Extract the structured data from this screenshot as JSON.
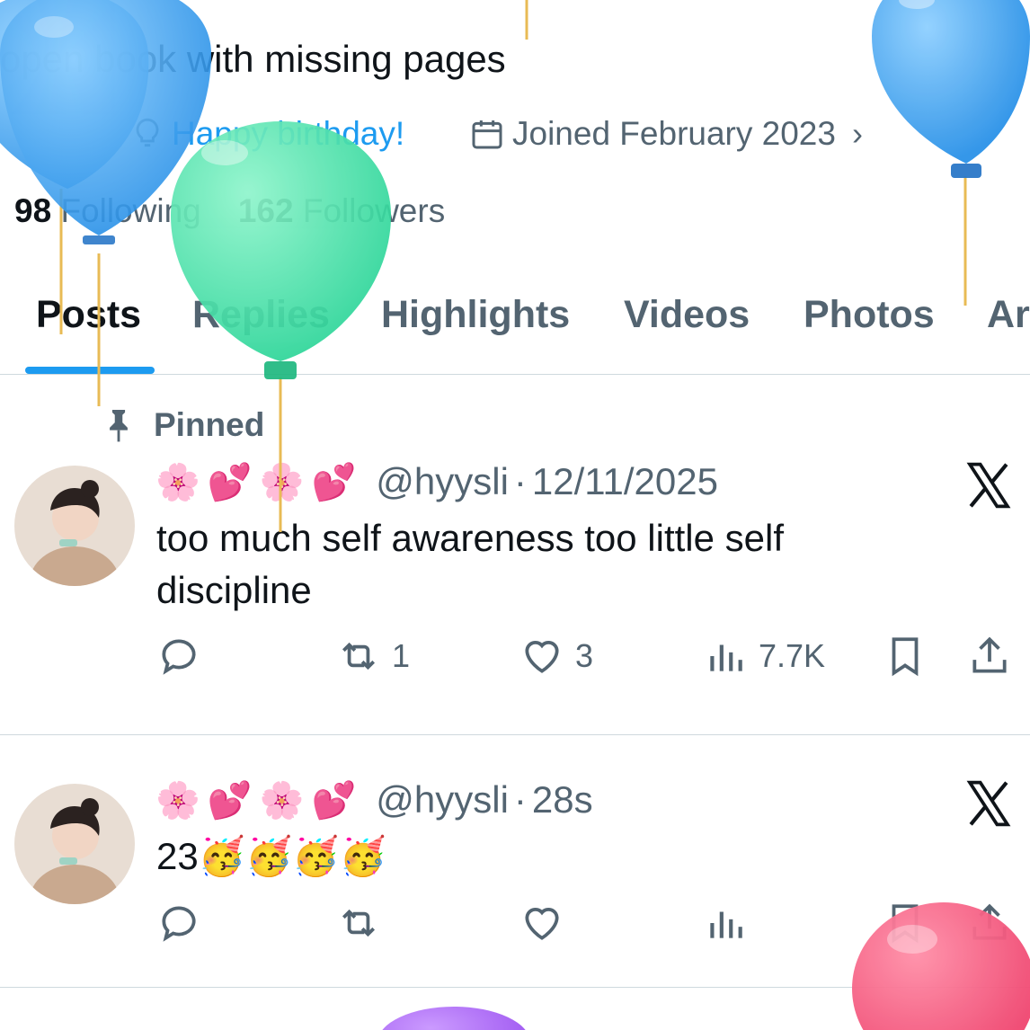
{
  "profile": {
    "bio": "open book with missing pages",
    "birthday": "Happy birthday!",
    "joined": "Joined February 2023",
    "following_count": "98",
    "following_label": "Following",
    "followers_count": "162",
    "followers_label": "Followers"
  },
  "tabs": [
    "Posts",
    "Replies",
    "Highlights",
    "Videos",
    "Photos",
    "Ar"
  ],
  "active_tab": "Posts",
  "colors": {
    "accent": "#1d9bf0",
    "muted": "#536471",
    "text": "#0f1419"
  },
  "pinned_label": "Pinned",
  "posts": [
    {
      "name_emojis": [
        "🌸",
        "💕",
        "🌸",
        "💕"
      ],
      "handle": "@hyysli",
      "sep": "·",
      "time": "12/11/2025",
      "text": "too much self awareness too little self discipline",
      "retweets": "1",
      "likes": "3",
      "views": "7.7K"
    },
    {
      "name_emojis": [
        "🌸",
        "💕",
        "🌸",
        "💕"
      ],
      "handle": "@hyysli",
      "sep": "·",
      "time": "28s",
      "text": "23🥳🥳🥳🥳",
      "retweets": "",
      "likes": "",
      "views": ""
    }
  ],
  "icons": [
    "location-bulb-icon",
    "calendar-icon",
    "chevron-right-icon",
    "pin-icon",
    "x-logo-icon",
    "reply-icon",
    "retweet-icon",
    "like-icon",
    "views-icon",
    "bookmark-icon",
    "share-icon"
  ]
}
